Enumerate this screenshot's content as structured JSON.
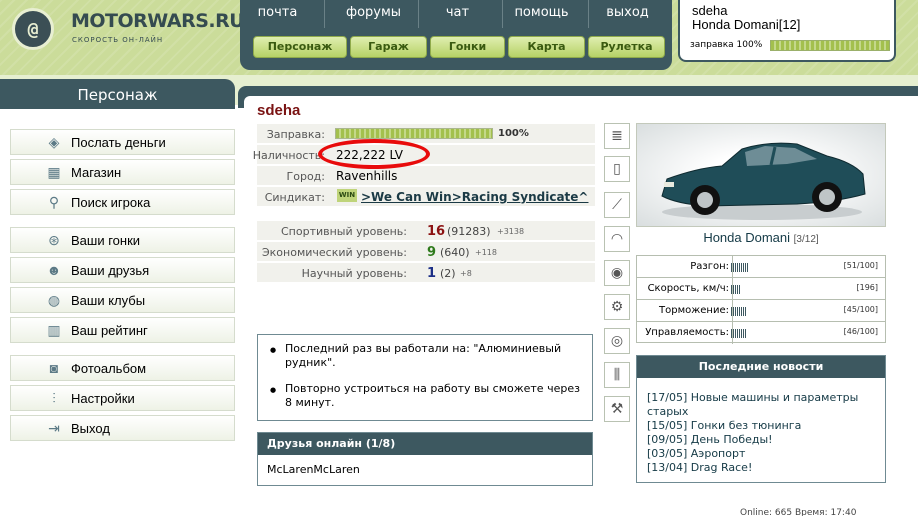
{
  "logo": {
    "title": "MOTORWARS.RU",
    "subtitle": "СКОРОСТЬ ОН-ЛАЙН",
    "mark": "@"
  },
  "topnav": [
    "почта",
    "форумы",
    "чат",
    "помощь",
    "выход"
  ],
  "mainnav": [
    "Персонаж",
    "Гараж",
    "Гонки",
    "Карта",
    "Рулетка"
  ],
  "user": {
    "name": "sdeha",
    "car": "Honda Domani[12]",
    "fuel_label": "заправка 100%",
    "fuel_percent": 100
  },
  "sidebar": {
    "title": "Персонаж",
    "items": [
      {
        "label": "Послать деньги",
        "icon": "money-icon"
      },
      {
        "label": "Магазин",
        "icon": "shop-icon"
      },
      {
        "label": "Поиск игрока",
        "icon": "search-icon"
      },
      {
        "label": "Ваши гонки",
        "icon": "steering-wheel-icon"
      },
      {
        "label": "Ваши друзья",
        "icon": "friends-icon"
      },
      {
        "label": "Ваши клубы",
        "icon": "globe-icon"
      },
      {
        "label": "Ваш рейтинг",
        "icon": "rating-icon"
      },
      {
        "label": "Фотоальбом",
        "icon": "camera-icon"
      },
      {
        "label": "Настройки",
        "icon": "settings-icon"
      },
      {
        "label": "Выход",
        "icon": "exit-icon"
      }
    ]
  },
  "profile": {
    "name": "sdeha",
    "fuel_label": "Заправка:",
    "fuel_percent_text": "100%",
    "fuel_percent": 100,
    "cash_label": "Наличность:",
    "cash_value": "222,222 LV",
    "city_label": "Город:",
    "city_value": "Ravenhills",
    "syndicate_label": "Синдикат:",
    "syndicate_badge": "WIN",
    "syndicate_value": ">We Can Win>Racing Syndicate^"
  },
  "levels": [
    {
      "label": "Спортивный уровень:",
      "level": "16",
      "points": "(91283)",
      "inc": "+3138",
      "color": "#8b1111"
    },
    {
      "label": "Экономический уровень:",
      "level": "9",
      "points": "(640)",
      "inc": "+118",
      "color": "#2f7a1c"
    },
    {
      "label": "Научный уровень:",
      "level": "1",
      "points": "(2)",
      "inc": "+8",
      "color": "#1b2e86"
    }
  ],
  "notes": [
    "Последний раз вы работали на: \"Алюминиевый рудник\".",
    "Повторно устроиться на работу вы сможете через 8 минут."
  ],
  "friends": {
    "title": "Друзья онлайн (1/8)",
    "list": "McLarenMcLaren"
  },
  "parts_icons": [
    "suspension-icon",
    "tire-icon",
    "exhaust-icon",
    "gauge-icon",
    "brake-disc-icon",
    "transmission-icon",
    "turbo-icon",
    "shock-absorber-icon",
    "tools-icon"
  ],
  "car": {
    "name": "Honda Domani",
    "slots": "[3/12]",
    "stats": [
      {
        "label": "Разгон:",
        "value": "[51/100]",
        "fraction": 0.51
      },
      {
        "label": "Скорость, км/ч:",
        "value": "[196]",
        "fraction": 0.25
      },
      {
        "label": "Торможение:",
        "value": "[45/100]",
        "fraction": 0.45
      },
      {
        "label": "Управляемость:",
        "value": "[46/100]",
        "fraction": 0.46
      }
    ]
  },
  "news": {
    "title": "Последние новости",
    "items": [
      "[17/05] Новые машины и параметры старых",
      "[15/05] Гонки без тюнинга",
      "[09/05] День Победы!",
      "[03/05] Аэропорт",
      "[13/04] Drag Race!"
    ]
  },
  "footer": "Online: 665   Время: 17:40"
}
